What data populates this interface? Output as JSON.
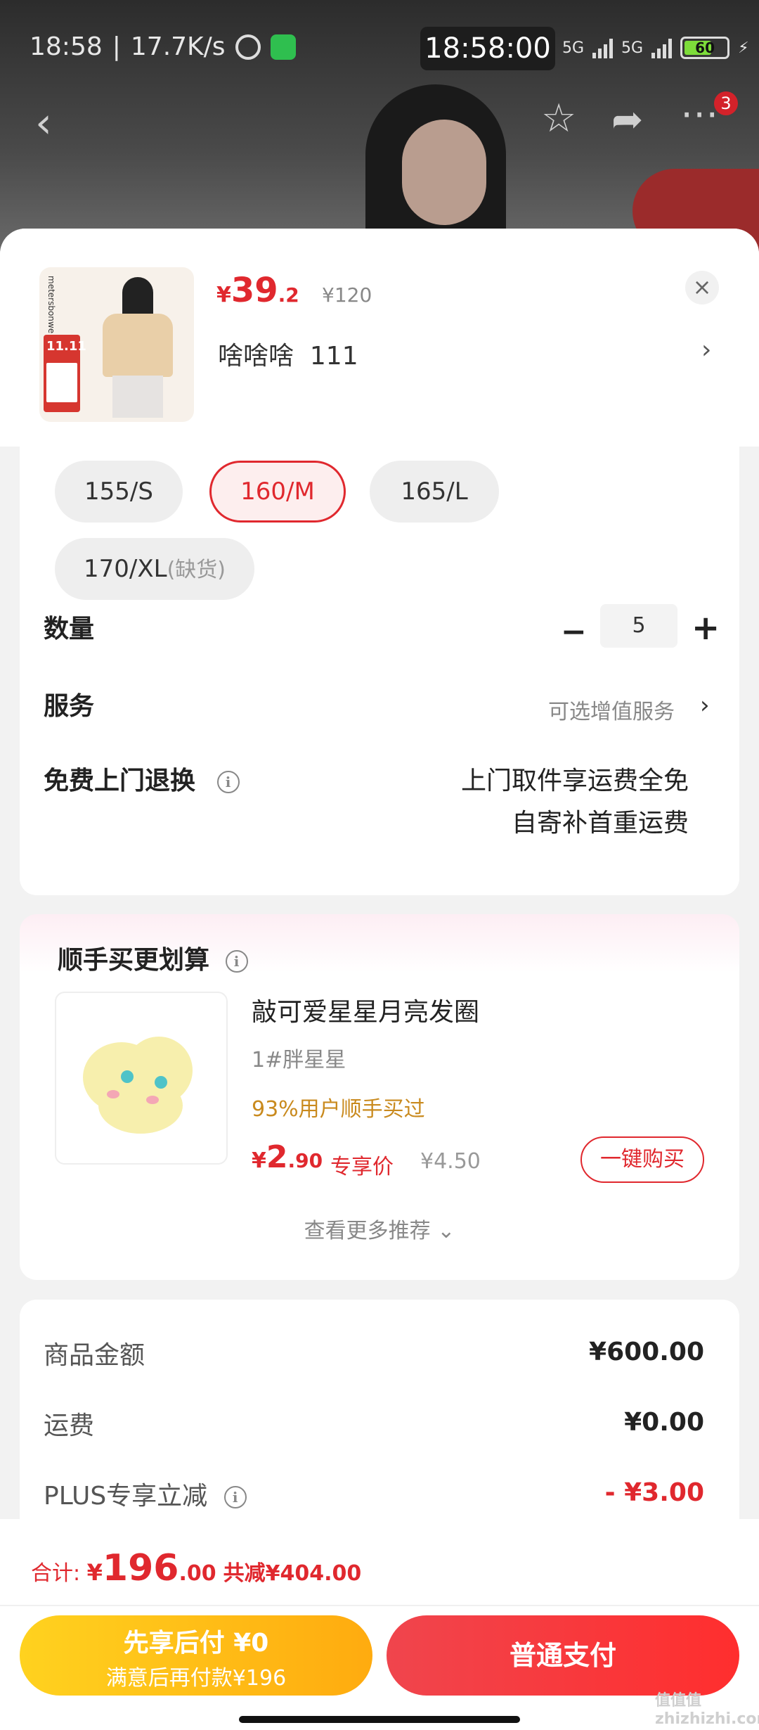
{
  "status": {
    "time": "18:58",
    "speed": "17.7K/s",
    "clock_overlay": "18:58:00",
    "network1": "5G",
    "network2": "5G",
    "battery": "60"
  },
  "nav": {
    "notification_count": "3"
  },
  "product": {
    "price_currency": "¥",
    "price_int": "39",
    "price_dec": ".2",
    "original_price": "¥120",
    "variant_name": "啥啥啥  111",
    "thumb_brand": "metersbonwe",
    "thumb_tag": "11.11"
  },
  "sizes": [
    {
      "label": "155/S",
      "selected": false
    },
    {
      "label": "160/M",
      "selected": true
    },
    {
      "label": "165/L",
      "selected": false
    },
    {
      "label": "170/XL",
      "note": "(缺货)",
      "selected": false
    }
  ],
  "quantity": {
    "label": "数量",
    "value": "5"
  },
  "service": {
    "label": "服务",
    "hint": "可选增值服务"
  },
  "return_service": {
    "label": "免费上门退换",
    "line1": "上门取件享运费全免",
    "line2": "自寄补首重运费"
  },
  "recommend": {
    "title": "顺手买更划算",
    "item_name": "敲可爱星星月亮发圈",
    "item_variant": "1#胖星星",
    "social_proof": "93%用户顺手买过",
    "price_currency": "¥",
    "price_int": "2",
    "price_dec": ".90",
    "exclusive_label": "专享价",
    "original_price": "¥4.50",
    "buy_button": "一键购买",
    "see_more": "查看更多推荐 ⌄"
  },
  "summary": {
    "rows": [
      {
        "label": "商品金额",
        "value": "¥600.00"
      },
      {
        "label": "运费",
        "value": "¥0.00"
      },
      {
        "label": "PLUS专享立减",
        "value": "- ¥3.00"
      }
    ]
  },
  "footer": {
    "total_label": "合计: ",
    "total_currency": "¥",
    "total_int": "196",
    "total_dec": ".00",
    "saved": "共减¥404.00",
    "bnpl_line1": "先享后付 ¥0",
    "bnpl_line2": "满意后再付款¥196",
    "pay_button": "普通支付",
    "watermark": "值值值 zhizhizhi.com"
  },
  "colors": {
    "accent_red": "#e0282e",
    "bnpl_yellow": "#ffc21a",
    "social_gold": "#c98a1e"
  },
  "icons": [
    "back-icon",
    "star-icon",
    "share-icon",
    "more-icon",
    "close-icon",
    "chevron-right-icon",
    "minus-icon",
    "plus-icon",
    "info-icon",
    "chevron-down-icon"
  ]
}
